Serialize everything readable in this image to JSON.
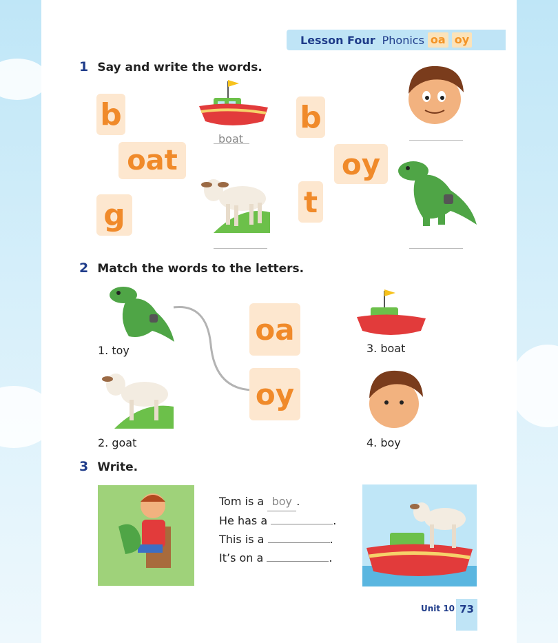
{
  "header": {
    "lesson": "Lesson Four",
    "topic": "Phonics",
    "chips": [
      "oa",
      "oy"
    ]
  },
  "section1": {
    "number": "1",
    "instruction": "Say and write the words.",
    "tiles": [
      "b",
      "oat",
      "g",
      "b",
      "oy",
      "t"
    ],
    "example_answer": "boat"
  },
  "section2": {
    "number": "2",
    "instruction": "Match the words to the letters.",
    "tiles": [
      "oa",
      "oy"
    ],
    "items": [
      "1. toy",
      "2. goat",
      "3. boat",
      "4. boy"
    ]
  },
  "section3": {
    "number": "3",
    "instruction": "Write.",
    "sentences": [
      {
        "before": "Tom is a",
        "answer": "boy",
        "after": "."
      },
      {
        "before": "He has a",
        "after": "."
      },
      {
        "before": "This is a",
        "after": "."
      },
      {
        "before": "It’s on a",
        "after": "."
      }
    ]
  },
  "footer": {
    "unit": "Unit 10",
    "page": "73"
  },
  "colors": {
    "navy": "#1f3c8a",
    "tile_bg": "#fde7cf",
    "tile_text": "#f08a2a",
    "banner": "#bfe4f6"
  }
}
